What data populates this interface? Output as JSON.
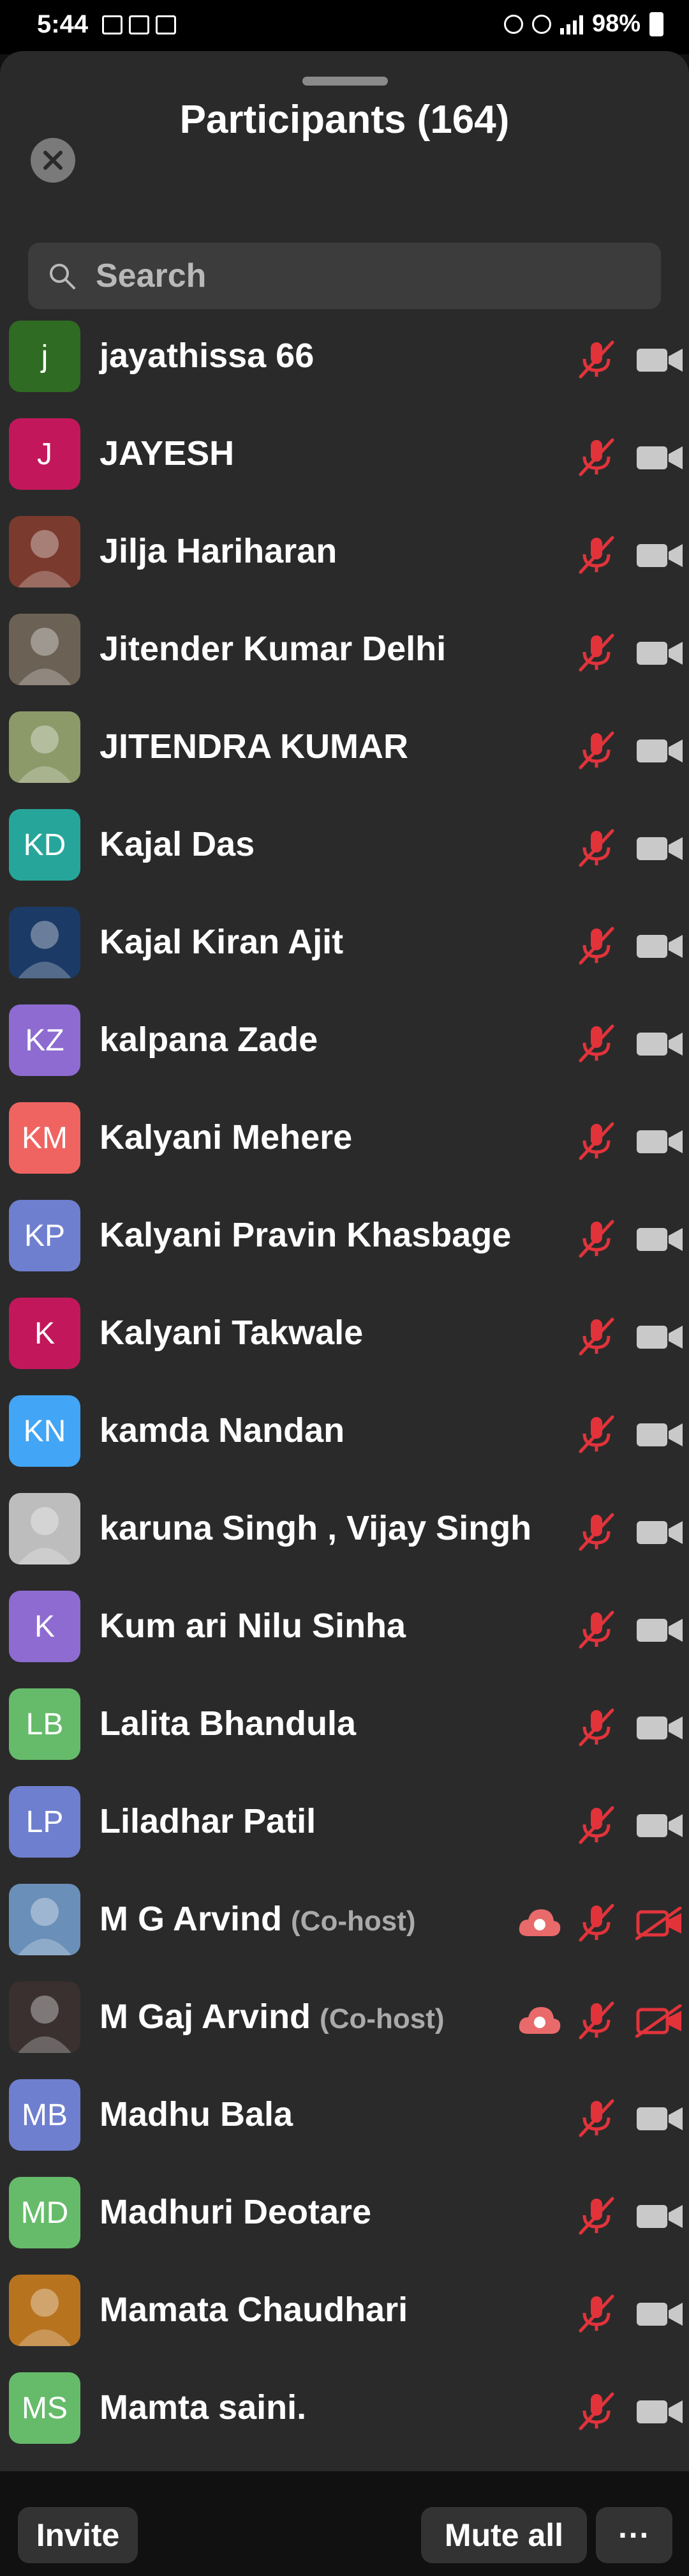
{
  "status": {
    "time": "5:44",
    "battery": "98%"
  },
  "header": {
    "title": "Participants (164)"
  },
  "search": {
    "placeholder": "Search"
  },
  "colors": {
    "sheet_bg": "#2a2a2a",
    "muted_red": "#e2333b",
    "camera_gray": "#c9c9c9"
  },
  "participants": [
    {
      "name": "jayathissa 66",
      "initials": "j",
      "avatar_color": "#2f6b22",
      "avatar_type": "initials",
      "cohost": "",
      "video": "off-gray"
    },
    {
      "name": "JAYESH",
      "initials": "J",
      "avatar_color": "#c2185b",
      "avatar_type": "initials",
      "cohost": "",
      "video": "off-gray"
    },
    {
      "name": "Jilja Hariharan",
      "initials": "",
      "avatar_color": "#7a3b2e",
      "avatar_type": "photo",
      "cohost": "",
      "video": "off-gray"
    },
    {
      "name": "Jitender Kumar Delhi",
      "initials": "",
      "avatar_color": "#6b6155",
      "avatar_type": "photo",
      "cohost": "",
      "video": "off-gray"
    },
    {
      "name": "JITENDRA KUMAR",
      "initials": "",
      "avatar_color": "#8c9a6a",
      "avatar_type": "photo",
      "cohost": "",
      "video": "off-gray"
    },
    {
      "name": "Kajal Das",
      "initials": "KD",
      "avatar_color": "#26a69a",
      "avatar_type": "initials",
      "cohost": "",
      "video": "off-gray"
    },
    {
      "name": "Kajal Kiran Ajit",
      "initials": "",
      "avatar_color": "#1b3a66",
      "avatar_type": "photo",
      "cohost": "",
      "video": "off-gray"
    },
    {
      "name": "kalpana Zade",
      "initials": "KZ",
      "avatar_color": "#8e6bd1",
      "avatar_type": "initials",
      "cohost": "",
      "video": "off-gray"
    },
    {
      "name": "Kalyani Mehere",
      "initials": "KM",
      "avatar_color": "#ef6461",
      "avatar_type": "initials",
      "cohost": "",
      "video": "off-gray"
    },
    {
      "name": "Kalyani Pravin Khasbage",
      "initials": "KP",
      "avatar_color": "#6f7fcf",
      "avatar_type": "initials",
      "cohost": "",
      "video": "off-gray"
    },
    {
      "name": "Kalyani Takwale",
      "initials": "K",
      "avatar_color": "#c2185b",
      "avatar_type": "initials",
      "cohost": "",
      "video": "off-gray"
    },
    {
      "name": "kamda Nandan",
      "initials": "KN",
      "avatar_color": "#42a5f5",
      "avatar_type": "initials",
      "cohost": "",
      "video": "off-gray"
    },
    {
      "name": "karuna Singh , Vijay Singh",
      "initials": "",
      "avatar_color": "#bdbdbd",
      "avatar_type": "photo",
      "cohost": "",
      "video": "off-gray"
    },
    {
      "name": "Kum  ari Nilu Sinha",
      "initials": "K",
      "avatar_color": "#8e6bd1",
      "avatar_type": "initials",
      "cohost": "",
      "video": "off-gray"
    },
    {
      "name": "Lalita Bhandula",
      "initials": "LB",
      "avatar_color": "#66bb6a",
      "avatar_type": "initials",
      "cohost": "",
      "video": "off-gray"
    },
    {
      "name": "Liladhar Patil",
      "initials": "LP",
      "avatar_color": "#6f7fcf",
      "avatar_type": "initials",
      "cohost": "",
      "video": "off-gray"
    },
    {
      "name": "M G Arvind",
      "initials": "",
      "avatar_color": "#6a8fb8",
      "avatar_type": "photo",
      "cohost": "(Co-host)",
      "video": "off-red"
    },
    {
      "name": "M Gaj Arvind",
      "initials": "",
      "avatar_color": "#3a3030",
      "avatar_type": "photo",
      "cohost": "(Co-host)",
      "video": "off-red"
    },
    {
      "name": "Madhu Bala",
      "initials": "MB",
      "avatar_color": "#6f7fcf",
      "avatar_type": "initials",
      "cohost": "",
      "video": "off-gray"
    },
    {
      "name": "Madhuri Deotare",
      "initials": "MD",
      "avatar_color": "#66bb6a",
      "avatar_type": "initials",
      "cohost": "",
      "video": "off-gray"
    },
    {
      "name": "Mamata Chaudhari",
      "initials": "",
      "avatar_color": "#b8731f",
      "avatar_type": "photo",
      "cohost": "",
      "video": "off-gray"
    },
    {
      "name": "Mamta saini.",
      "initials": "MS",
      "avatar_color": "#66bb6a",
      "avatar_type": "initials",
      "cohost": "",
      "video": "off-gray"
    }
  ],
  "footer": {
    "invite_label": "Invite",
    "mute_all_label": "Mute all",
    "more_label": "···"
  }
}
